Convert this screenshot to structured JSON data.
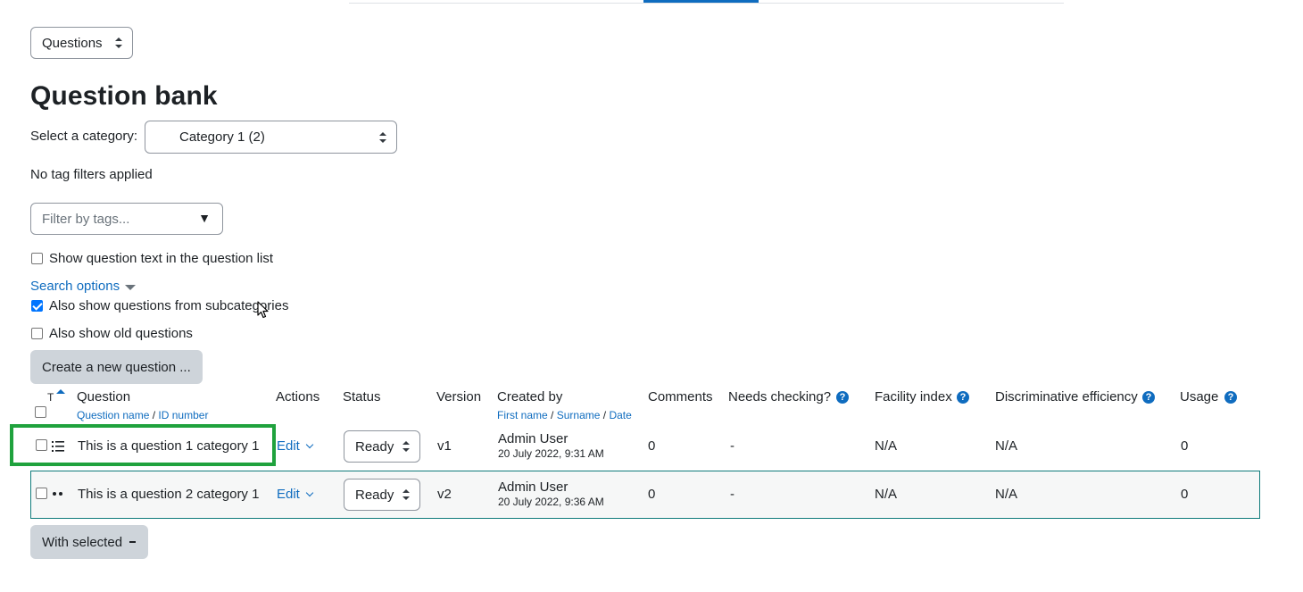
{
  "view_select": {
    "value": "Questions"
  },
  "page_title": "Question bank",
  "category": {
    "label": "Select a category:",
    "value": "Category 1 (2)"
  },
  "tag_filters_text": "No tag filters applied",
  "tags_filter": {
    "placeholder": "Filter by tags..."
  },
  "show_question_text": {
    "label": "Show question text in the question list",
    "checked": false
  },
  "search_options": {
    "label": "Search options"
  },
  "subcategories": {
    "label": "Also show questions from subcategories",
    "checked": true
  },
  "old_questions": {
    "label": "Also show old questions",
    "checked": false
  },
  "create_button": "Create a new question ...",
  "table": {
    "headers": {
      "type": "T",
      "question": "Question",
      "question_name": "Question name",
      "slash": "/",
      "id_number": "ID number",
      "actions": "Actions",
      "status": "Status",
      "version": "Version",
      "created_by": "Created by",
      "first_name": "First name",
      "surname": "Surname",
      "date": "Date",
      "comments": "Comments",
      "needs_checking": "Needs checking?",
      "facility_index": "Facility index",
      "discriminative_efficiency": "Discriminative efficiency",
      "usage": "Usage"
    },
    "rows": [
      {
        "question": "This is a question 1 category 1",
        "type_icon": "multichoice-icon",
        "action": "Edit",
        "status": "Ready",
        "version": "v1",
        "creator": "Admin User",
        "created_date": "20 July 2022, 9:31 AM",
        "comments": "0",
        "needs_checking": "-",
        "facility_index": "N/A",
        "discriminative_efficiency": "N/A",
        "usage": "0"
      },
      {
        "question": "This is a question 2 category 1",
        "type_icon": "truefalse-icon",
        "action": "Edit",
        "status": "Ready",
        "version": "v2",
        "creator": "Admin User",
        "created_date": "20 July 2022, 9:36 AM",
        "comments": "0",
        "needs_checking": "-",
        "facility_index": "N/A",
        "discriminative_efficiency": "N/A",
        "usage": "0"
      }
    ]
  },
  "with_selected": "With selected",
  "colors": {
    "link": "#0f6cbf",
    "highlight": "#1fa23d",
    "row_border": "#0f7b7b",
    "button_grey": "#ced4da"
  }
}
